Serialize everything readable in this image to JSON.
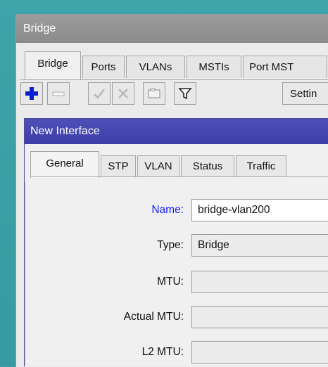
{
  "window": {
    "title": "Bridge",
    "tabs": [
      "Bridge",
      "Ports",
      "VLANs",
      "MSTIs",
      "Port MST"
    ],
    "toolbar": {
      "settings_label": "Settin"
    }
  },
  "dialog": {
    "title": "New Interface",
    "tabs": [
      "General",
      "STP",
      "VLAN",
      "Status",
      "Traffic"
    ],
    "fields": {
      "name_label": "Name:",
      "name_value": "bridge-vlan200",
      "type_label": "Type:",
      "type_value": "Bridge",
      "mtu_label": "MTU:",
      "actual_mtu_label": "Actual MTU:",
      "l2mtu_label": "L2 MTU:"
    }
  },
  "icons": {
    "add": "plus-icon",
    "remove": "minus-icon",
    "enable": "check-icon",
    "disable": "x-icon",
    "comment": "comment-icon",
    "filter": "filter-icon"
  },
  "colors": {
    "accent_blue": "#0a1ed0",
    "dialog_title": "#4545b0",
    "label_highlight": "#1a1aff"
  }
}
